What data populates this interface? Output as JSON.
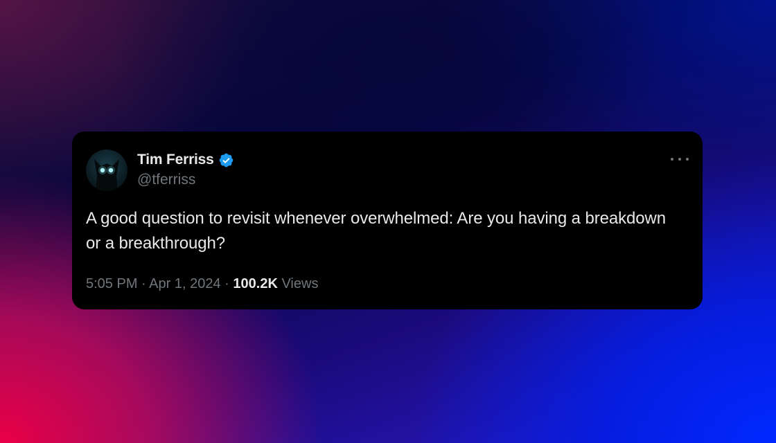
{
  "tweet": {
    "author": {
      "name": "Tim Ferriss",
      "handle": "@tferriss",
      "verified": true,
      "verified_color": "#1d9bf0"
    },
    "text": "A good question to revisit whenever overwhelmed: Are you having a breakdown or a breakthrough?",
    "time": "5:05 PM",
    "date": "Apr 1, 2024",
    "separator": "·",
    "views_count": "100.2K",
    "views_label": "Views",
    "more_icon": "more-horizontal-icon"
  },
  "colors": {
    "card_background": "#000000",
    "primary_text": "#e7e9ea",
    "secondary_text": "#71767b",
    "background_pink": "#e8004a",
    "background_blue": "#0022ff",
    "background_navy": "#06063e"
  }
}
